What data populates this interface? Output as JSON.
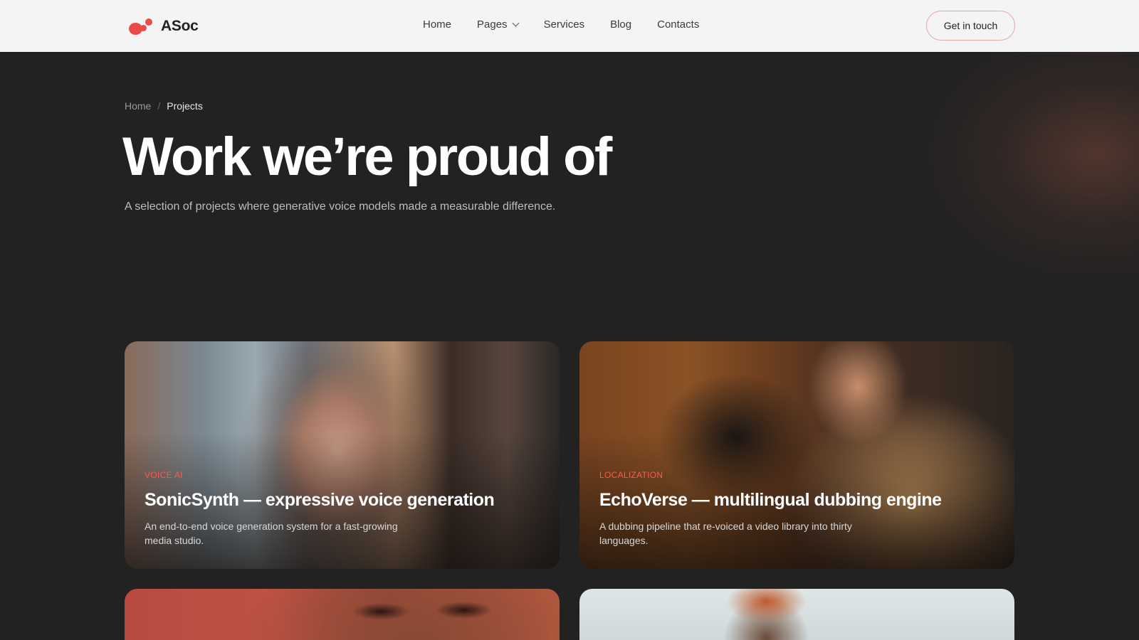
{
  "brand": {
    "name": "ASoc",
    "accent": "#ea4a4a"
  },
  "nav": {
    "items": [
      {
        "label": "Home"
      },
      {
        "label": "Pages",
        "has_dropdown": true
      },
      {
        "label": "Services"
      },
      {
        "label": "Blog"
      },
      {
        "label": "Contacts"
      }
    ],
    "cta_label": "Get in touch"
  },
  "breadcrumb": {
    "home": "Home",
    "separator": "/",
    "current": "Projects"
  },
  "hero": {
    "title": "Work we’re proud of",
    "subtitle": "A selection of projects where generative voice models made a measurable difference."
  },
  "projects": [
    {
      "tag": "VOICE AI",
      "title": "SonicSynth — expressive voice generation",
      "description": "An end-to-end voice generation system for a fast-growing media studio."
    },
    {
      "tag": "LOCALIZATION",
      "title": "EchoVerse — multilingual dubbing engine",
      "description": "A dubbing pipeline that re-voiced a video library into thirty languages."
    },
    {
      "tag": "",
      "title": "",
      "description": ""
    },
    {
      "tag": "",
      "title": "",
      "description": ""
    }
  ]
}
